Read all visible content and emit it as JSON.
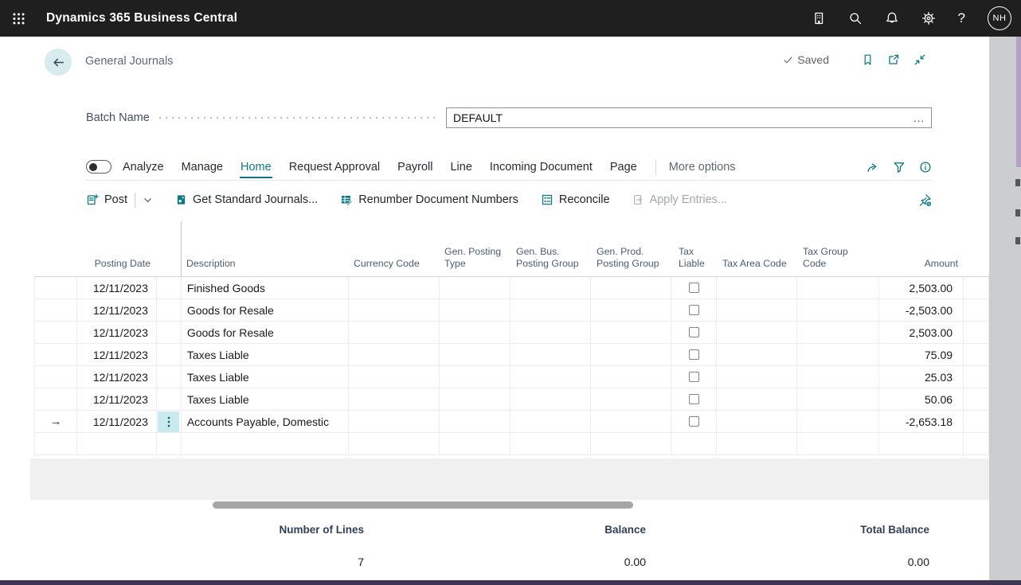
{
  "topbar": {
    "app_title": "Dynamics 365 Business Central",
    "avatar_initials": "NH"
  },
  "page": {
    "title": "General Journals",
    "save_status": "Saved"
  },
  "batch": {
    "label": "Batch Name",
    "value": "DEFAULT",
    "assist_edit": "..."
  },
  "menu": {
    "analyze_label": "Analyze",
    "tabs": [
      {
        "label": "Manage"
      },
      {
        "label": "Home"
      },
      {
        "label": "Request Approval"
      },
      {
        "label": "Payroll"
      },
      {
        "label": "Line"
      },
      {
        "label": "Incoming Document"
      },
      {
        "label": "Page"
      }
    ],
    "more_options": "More options"
  },
  "actions": {
    "post": "Post",
    "get_standard_journals": "Get Standard Journals...",
    "renumber": "Renumber Document Numbers",
    "reconcile": "Reconcile",
    "apply_entries": "Apply Entries..."
  },
  "table": {
    "columns": [
      "Posting Date",
      "Description",
      "Currency Code",
      "Gen. Posting Type",
      "Gen. Bus. Posting Group",
      "Gen. Prod. Posting Group",
      "Tax Liable",
      "Tax Area Code",
      "Tax Group Code",
      "Amount"
    ],
    "rows": [
      {
        "posting_date": "12/11/2023",
        "description": "Finished Goods",
        "amount": "2,503.00"
      },
      {
        "posting_date": "12/11/2023",
        "description": "Goods for Resale",
        "amount": "-2,503.00"
      },
      {
        "posting_date": "12/11/2023",
        "description": "Goods for Resale",
        "amount": "2,503.00"
      },
      {
        "posting_date": "12/11/2023",
        "description": "Taxes Liable",
        "amount": "75.09"
      },
      {
        "posting_date": "12/11/2023",
        "description": "Taxes Liable",
        "amount": "25.03"
      },
      {
        "posting_date": "12/11/2023",
        "description": "Taxes Liable",
        "amount": "50.06"
      },
      {
        "posting_date": "12/11/2023",
        "description": "Accounts Payable, Domestic",
        "amount": "-2,653.18"
      }
    ]
  },
  "footer": {
    "number_of_lines_label": "Number of Lines",
    "number_of_lines": "7",
    "balance_label": "Balance",
    "balance": "0.00",
    "total_balance_label": "Total Balance",
    "total_balance": "0.00"
  },
  "colors": {
    "accent": "#0e7882",
    "topbar_bg": "#1f1f1f",
    "active_cell_bg": "#c9ebef"
  }
}
